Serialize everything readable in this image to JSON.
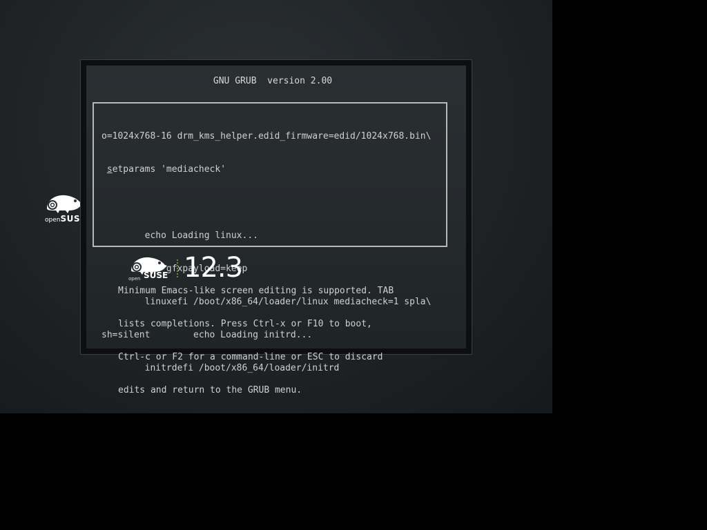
{
  "title": "GNU GRUB  version 2.00",
  "editor": {
    "lines": [
      "o=1024x768-16 drm_kms_helper.edid_firmware=edid/1024x768.bin\\",
      " setparams 'mediacheck'",
      "",
      "        echo Loading linux...",
      "        set gfxpayload=keep",
      "        linuxefi /boot/x86_64/loader/linux mediacheck=1 spla\\",
      "sh=silent        echo Loading initrd...",
      "        initrdefi /boot/x86_64/loader/initrd"
    ],
    "cursor_char": "s",
    "cursor_line_rest": "etparams 'mediacheck'"
  },
  "help": {
    "lines": [
      "Minimum Emacs-like screen editing is supported. TAB",
      "lists completions. Press Ctrl-x or F10 to boot,",
      "Ctrl-c or F2 for a command-line or ESC to discard",
      "edits and return to the GRUB menu."
    ]
  },
  "logo_left": {
    "small": "open",
    "big": "SUSE"
  },
  "overlay_logo": {
    "open": "open",
    "suse": "SUSE",
    "version": "12.3"
  },
  "colors": {
    "text": "#d0d0d0",
    "border": "#b9b9b9",
    "accent_green": "#6a8a3a"
  }
}
